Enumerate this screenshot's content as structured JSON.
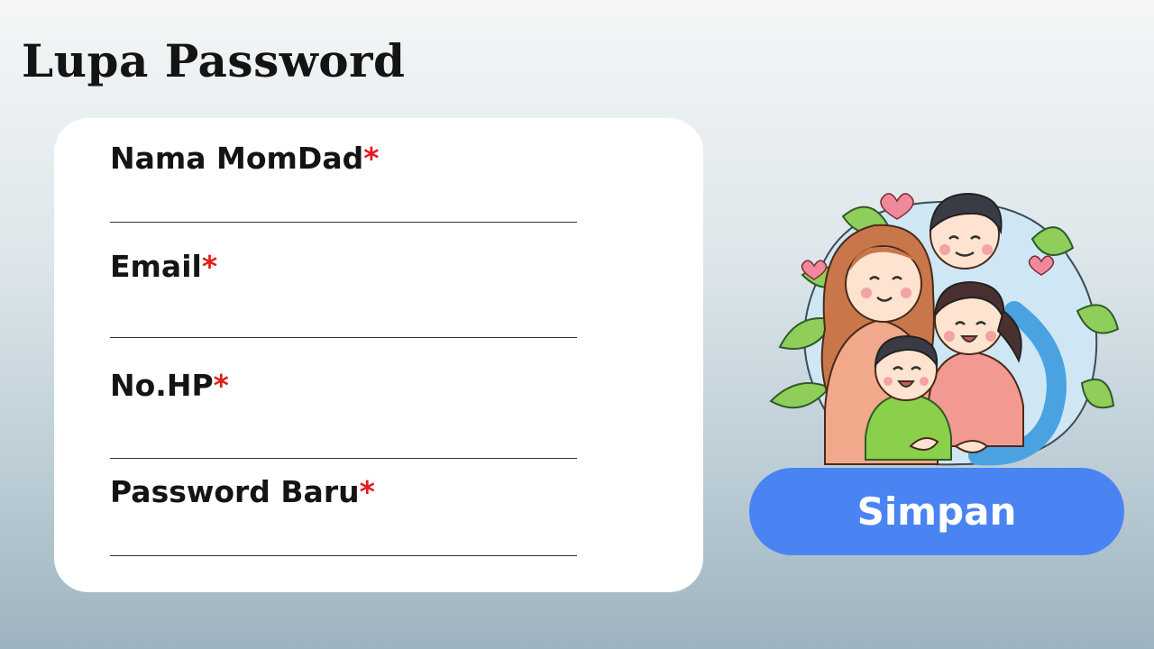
{
  "page": {
    "title": "Lupa Password"
  },
  "form": {
    "fields": [
      {
        "label": "Nama MomDad",
        "required_mark": "*",
        "value": ""
      },
      {
        "label": "Email",
        "required_mark": "*",
        "value": ""
      },
      {
        "label": "No.HP",
        "required_mark": "*",
        "value": ""
      },
      {
        "label": "Password Baru",
        "required_mark": "*",
        "value": ""
      }
    ]
  },
  "actions": {
    "save_label": "Simpan"
  },
  "colors": {
    "accent": "#4a84f2",
    "required": "#e21b1b",
    "card": "#ffffff"
  }
}
